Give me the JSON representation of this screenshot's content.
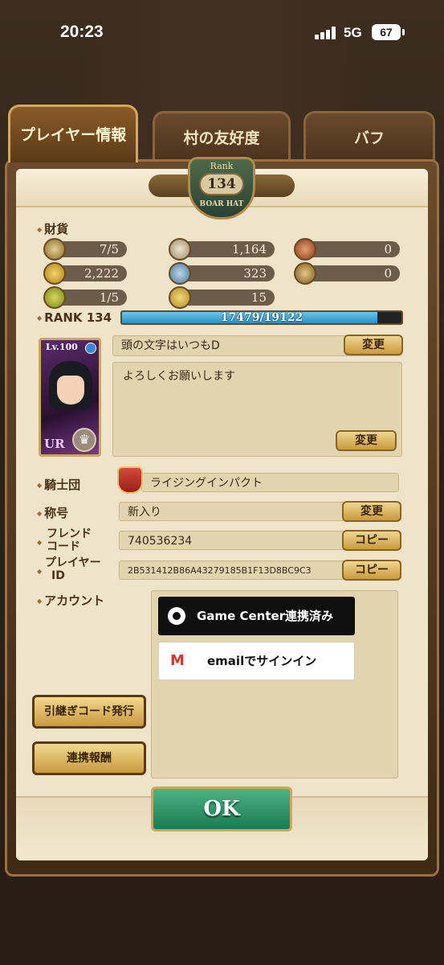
{
  "status": {
    "time": "20:23",
    "network": "5G",
    "battery": "67"
  },
  "tabs": [
    {
      "label": "プレイヤー情報"
    },
    {
      "label": "村の友好度"
    },
    {
      "label": "バフ"
    }
  ],
  "rank_badge": {
    "label": "Rank",
    "value": "134",
    "subtitle": "BOAR HAT"
  },
  "currency": {
    "label": "財貨",
    "items": [
      {
        "icon": "swords-icon",
        "value": "7/5"
      },
      {
        "icon": "silver-coin-icon",
        "value": "1,164"
      },
      {
        "icon": "red-medal-icon",
        "value": "0"
      },
      {
        "icon": "gold-coin-icon",
        "value": "2,222"
      },
      {
        "icon": "blue-coin-icon",
        "value": "323"
      },
      {
        "icon": "gold-medal-icon",
        "value": "0"
      },
      {
        "icon": "green-orb-icon",
        "value": "1/5"
      },
      {
        "icon": "gold-ring-icon",
        "value": "15"
      }
    ]
  },
  "rank": {
    "label": "RANK 134",
    "progress_text": "17479/19122",
    "progress": 0.914
  },
  "card": {
    "level": "Lv.100",
    "rarity": "UR"
  },
  "profile": {
    "title_text": "頭の文字はいつもD",
    "change_label": "変更",
    "comment": "よろしくお願いします",
    "comment_change_label": "変更"
  },
  "guild": {
    "label": "騎士団",
    "name": "ライジングインパクト"
  },
  "honor": {
    "label": "称号",
    "value": "新入り",
    "change_label": "変更"
  },
  "friend_code": {
    "label_line1": "フレンド",
    "label_line2": "コード",
    "value": "740536234",
    "copy_label": "コピー"
  },
  "player_id": {
    "label_line1": "プレイヤー",
    "label_line2": "ID",
    "value": "2B531412B86A43279185B1F13D8BC9C3",
    "copy_label": "コピー"
  },
  "account": {
    "label": "アカウント",
    "game_center": "Game Center連携済み",
    "email": "emailでサインイン",
    "email_icon": "M"
  },
  "buttons": {
    "transfer_code": "引継ぎコード発行",
    "link_reward": "連携報酬",
    "ok": "OK"
  },
  "colors": {
    "accent_gold": "#c99a3e",
    "ok_green": "#1b7a52",
    "progress_blue": "#2b8fc0"
  }
}
